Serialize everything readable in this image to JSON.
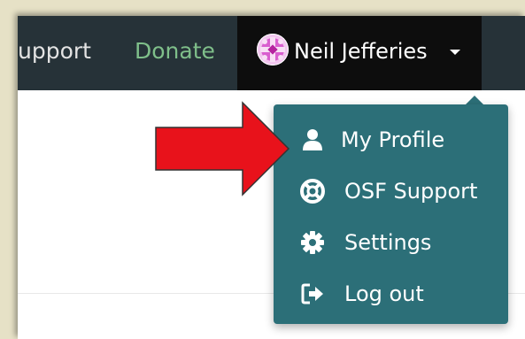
{
  "navbar": {
    "support_label": "upport",
    "donate_label": "Donate",
    "user_name": "Neil Jefferies"
  },
  "user_menu": {
    "items": [
      {
        "label": "My Profile",
        "icon": "user-icon"
      },
      {
        "label": "OSF Support",
        "icon": "life-ring-icon"
      },
      {
        "label": "Settings",
        "icon": "gear-icon"
      },
      {
        "label": "Log out",
        "icon": "sign-out-icon"
      }
    ]
  },
  "annotation": {
    "icon": "red-arrow",
    "color": "#e8121b"
  },
  "colors": {
    "navbar_bg": "#263238",
    "dropdown_bg": "#2c6f78",
    "donate_text": "#7fbf8a"
  }
}
